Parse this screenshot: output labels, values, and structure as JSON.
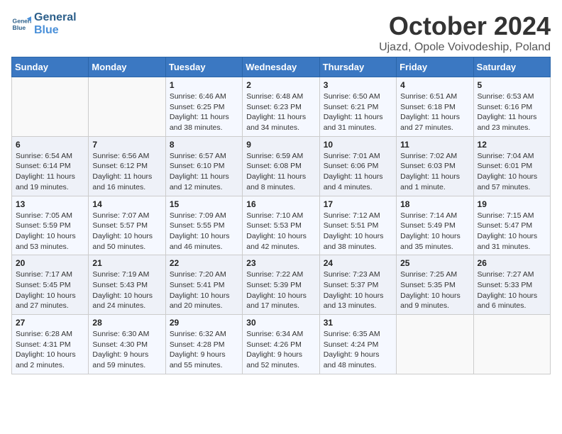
{
  "logo": {
    "text_general": "General",
    "text_blue": "Blue"
  },
  "title": {
    "month_year": "October 2024",
    "location": "Ujazd, Opole Voivodeship, Poland"
  },
  "days_of_week": [
    "Sunday",
    "Monday",
    "Tuesday",
    "Wednesday",
    "Thursday",
    "Friday",
    "Saturday"
  ],
  "weeks": [
    [
      {
        "day": "",
        "data": ""
      },
      {
        "day": "",
        "data": ""
      },
      {
        "day": "1",
        "data": "Sunrise: 6:46 AM\nSunset: 6:25 PM\nDaylight: 11 hours\nand 38 minutes."
      },
      {
        "day": "2",
        "data": "Sunrise: 6:48 AM\nSunset: 6:23 PM\nDaylight: 11 hours\nand 34 minutes."
      },
      {
        "day": "3",
        "data": "Sunrise: 6:50 AM\nSunset: 6:21 PM\nDaylight: 11 hours\nand 31 minutes."
      },
      {
        "day": "4",
        "data": "Sunrise: 6:51 AM\nSunset: 6:18 PM\nDaylight: 11 hours\nand 27 minutes."
      },
      {
        "day": "5",
        "data": "Sunrise: 6:53 AM\nSunset: 6:16 PM\nDaylight: 11 hours\nand 23 minutes."
      }
    ],
    [
      {
        "day": "6",
        "data": "Sunrise: 6:54 AM\nSunset: 6:14 PM\nDaylight: 11 hours\nand 19 minutes."
      },
      {
        "day": "7",
        "data": "Sunrise: 6:56 AM\nSunset: 6:12 PM\nDaylight: 11 hours\nand 16 minutes."
      },
      {
        "day": "8",
        "data": "Sunrise: 6:57 AM\nSunset: 6:10 PM\nDaylight: 11 hours\nand 12 minutes."
      },
      {
        "day": "9",
        "data": "Sunrise: 6:59 AM\nSunset: 6:08 PM\nDaylight: 11 hours\nand 8 minutes."
      },
      {
        "day": "10",
        "data": "Sunrise: 7:01 AM\nSunset: 6:06 PM\nDaylight: 11 hours\nand 4 minutes."
      },
      {
        "day": "11",
        "data": "Sunrise: 7:02 AM\nSunset: 6:03 PM\nDaylight: 11 hours\nand 1 minute."
      },
      {
        "day": "12",
        "data": "Sunrise: 7:04 AM\nSunset: 6:01 PM\nDaylight: 10 hours\nand 57 minutes."
      }
    ],
    [
      {
        "day": "13",
        "data": "Sunrise: 7:05 AM\nSunset: 5:59 PM\nDaylight: 10 hours\nand 53 minutes."
      },
      {
        "day": "14",
        "data": "Sunrise: 7:07 AM\nSunset: 5:57 PM\nDaylight: 10 hours\nand 50 minutes."
      },
      {
        "day": "15",
        "data": "Sunrise: 7:09 AM\nSunset: 5:55 PM\nDaylight: 10 hours\nand 46 minutes."
      },
      {
        "day": "16",
        "data": "Sunrise: 7:10 AM\nSunset: 5:53 PM\nDaylight: 10 hours\nand 42 minutes."
      },
      {
        "day": "17",
        "data": "Sunrise: 7:12 AM\nSunset: 5:51 PM\nDaylight: 10 hours\nand 38 minutes."
      },
      {
        "day": "18",
        "data": "Sunrise: 7:14 AM\nSunset: 5:49 PM\nDaylight: 10 hours\nand 35 minutes."
      },
      {
        "day": "19",
        "data": "Sunrise: 7:15 AM\nSunset: 5:47 PM\nDaylight: 10 hours\nand 31 minutes."
      }
    ],
    [
      {
        "day": "20",
        "data": "Sunrise: 7:17 AM\nSunset: 5:45 PM\nDaylight: 10 hours\nand 27 minutes."
      },
      {
        "day": "21",
        "data": "Sunrise: 7:19 AM\nSunset: 5:43 PM\nDaylight: 10 hours\nand 24 minutes."
      },
      {
        "day": "22",
        "data": "Sunrise: 7:20 AM\nSunset: 5:41 PM\nDaylight: 10 hours\nand 20 minutes."
      },
      {
        "day": "23",
        "data": "Sunrise: 7:22 AM\nSunset: 5:39 PM\nDaylight: 10 hours\nand 17 minutes."
      },
      {
        "day": "24",
        "data": "Sunrise: 7:23 AM\nSunset: 5:37 PM\nDaylight: 10 hours\nand 13 minutes."
      },
      {
        "day": "25",
        "data": "Sunrise: 7:25 AM\nSunset: 5:35 PM\nDaylight: 10 hours\nand 9 minutes."
      },
      {
        "day": "26",
        "data": "Sunrise: 7:27 AM\nSunset: 5:33 PM\nDaylight: 10 hours\nand 6 minutes."
      }
    ],
    [
      {
        "day": "27",
        "data": "Sunrise: 6:28 AM\nSunset: 4:31 PM\nDaylight: 10 hours\nand 2 minutes."
      },
      {
        "day": "28",
        "data": "Sunrise: 6:30 AM\nSunset: 4:30 PM\nDaylight: 9 hours\nand 59 minutes."
      },
      {
        "day": "29",
        "data": "Sunrise: 6:32 AM\nSunset: 4:28 PM\nDaylight: 9 hours\nand 55 minutes."
      },
      {
        "day": "30",
        "data": "Sunrise: 6:34 AM\nSunset: 4:26 PM\nDaylight: 9 hours\nand 52 minutes."
      },
      {
        "day": "31",
        "data": "Sunrise: 6:35 AM\nSunset: 4:24 PM\nDaylight: 9 hours\nand 48 minutes."
      },
      {
        "day": "",
        "data": ""
      },
      {
        "day": "",
        "data": ""
      }
    ]
  ]
}
